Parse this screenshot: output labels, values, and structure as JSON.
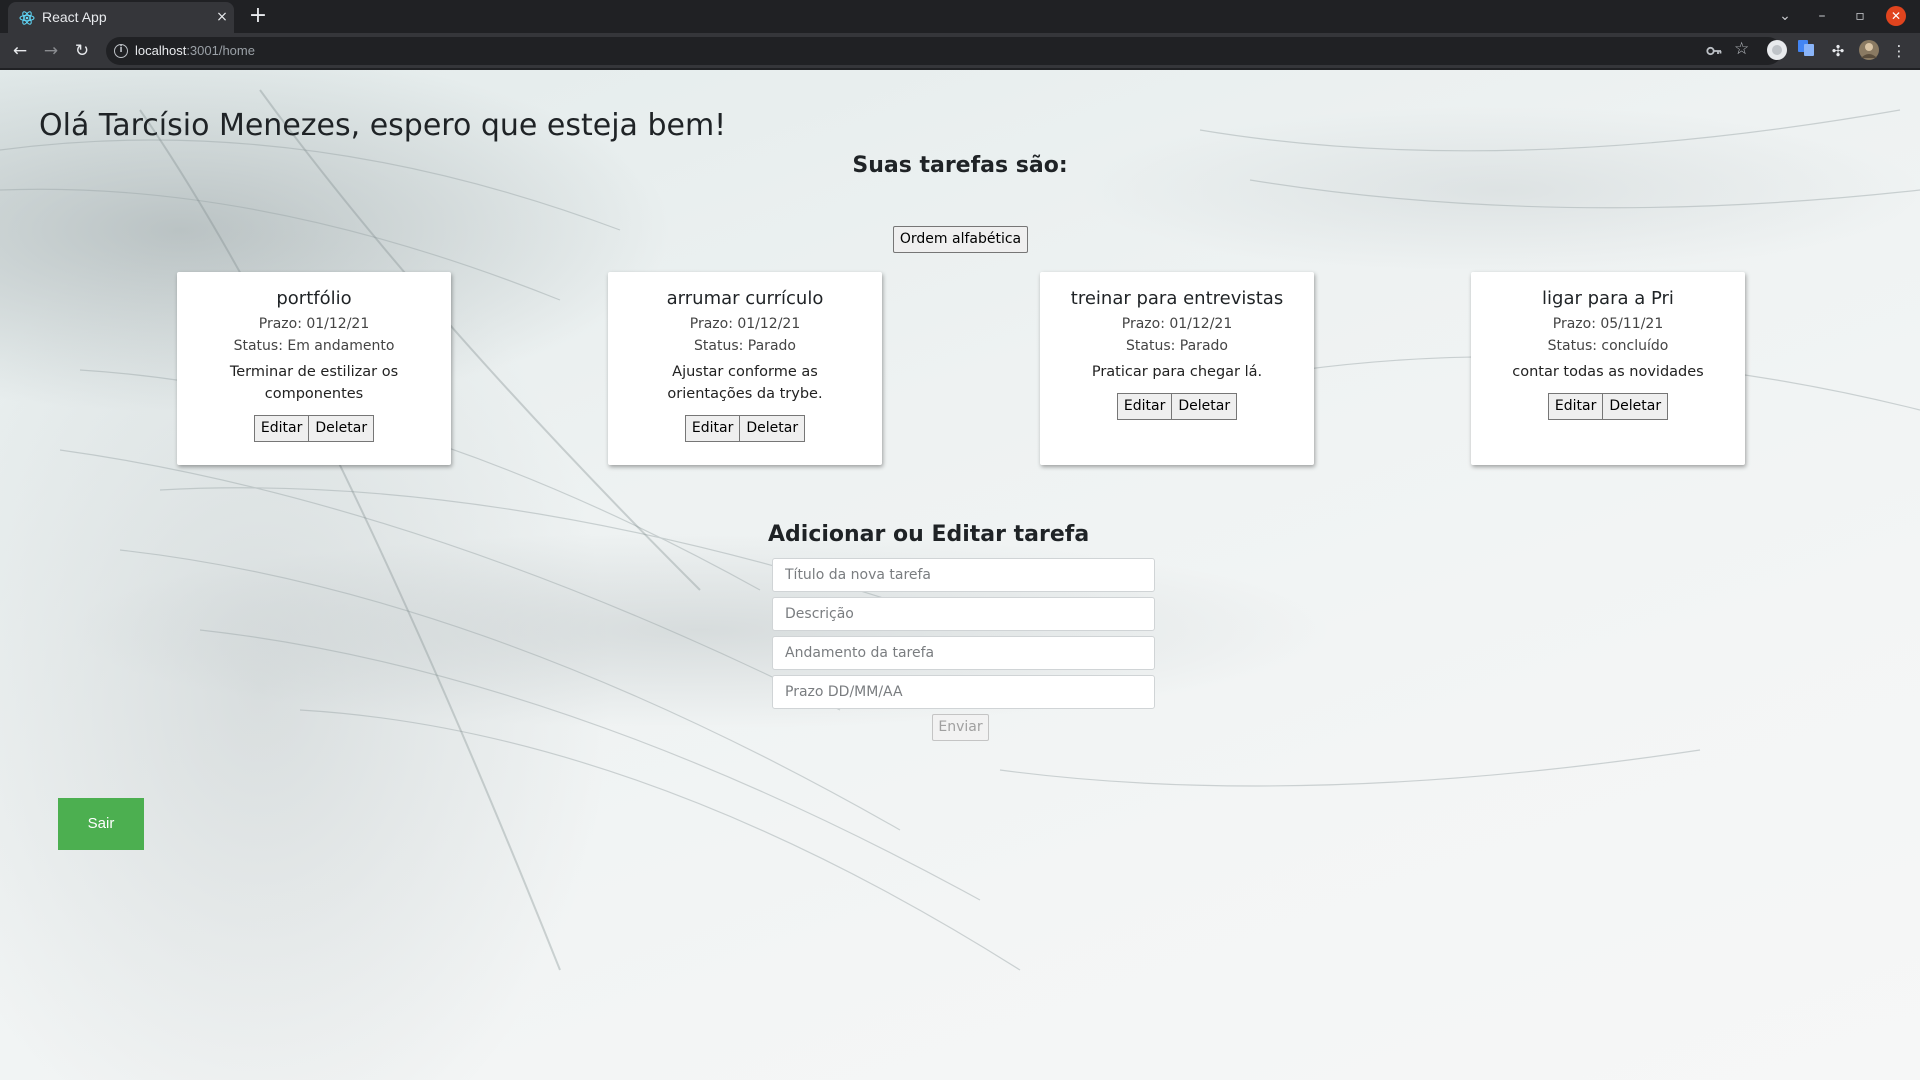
{
  "browser": {
    "tab_title": "React App",
    "tab_close_icon": "×",
    "new_tab_icon": "+",
    "url_host": "localhost",
    "url_rest": ":3001/home",
    "window_controls": {
      "dropdown": "⌄",
      "minimize": "–",
      "restore": "▫",
      "close": "✕"
    }
  },
  "page": {
    "greeting": "Olá Tarcísio Menezes, espero que esteja bem!",
    "tasks_heading": "Suas tarefas são:",
    "sort_button": "Ordem alfabética",
    "tasks": [
      {
        "title": "portfólio",
        "deadline": "Prazo: 01/12/21",
        "status": "Status: Em andamento",
        "description": "Terminar de estilizar os componentes",
        "edit_label": "Editar",
        "delete_label": "Deletar"
      },
      {
        "title": "arrumar currículo",
        "deadline": "Prazo: 01/12/21",
        "status": "Status: Parado",
        "description": "Ajustar conforme as orientações da trybe.",
        "edit_label": "Editar",
        "delete_label": "Deletar"
      },
      {
        "title": "treinar para entrevistas",
        "deadline": "Prazo: 01/12/21",
        "status": "Status: Parado",
        "description": "Praticar para chegar lá.",
        "edit_label": "Editar",
        "delete_label": "Deletar"
      },
      {
        "title": "ligar para a Pri",
        "deadline": "Prazo: 05/11/21",
        "status": "Status: concluído",
        "description": "contar todas as novidades",
        "edit_label": "Editar",
        "delete_label": "Deletar"
      }
    ],
    "form": {
      "title": "Adicionar ou Editar tarefa",
      "title_placeholder": "Título da nova tarefa",
      "description_placeholder": "Descrição",
      "status_placeholder": "Andamento da tarefa",
      "deadline_placeholder": "Prazo DD/MM/AA",
      "submit_label": "Enviar"
    },
    "logout_label": "Sair"
  },
  "colors": {
    "logout_button": "#4caf50",
    "browser_frame": "#202124",
    "browser_toolbar": "#35363a",
    "close_button": "#e0441e"
  }
}
